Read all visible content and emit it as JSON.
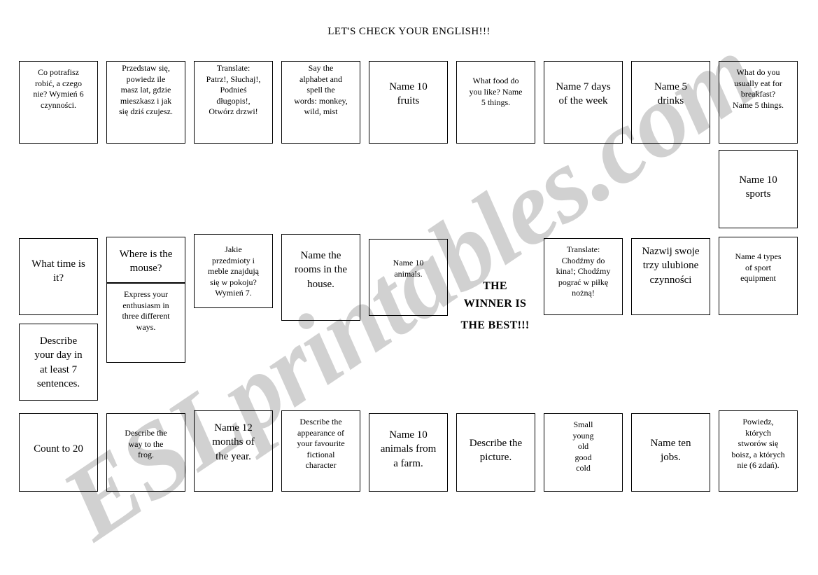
{
  "page": {
    "title": "LET'S CHECK YOUR ENGLISH!!!",
    "watermark": "ESLprintables.com",
    "background_color": "#ffffff",
    "border_color": "#000000",
    "watermark_color": "#c9c9c9"
  },
  "winner": {
    "line1": "THE",
    "line2": "WINNER IS",
    "line3": "THE BEST!!!"
  },
  "rows": {
    "top": [
      {
        "text": "Co potrafisz\nrobić, a czego\nnie? Wymień 6\nczynności."
      },
      {
        "text": "Przedstaw się,\npowiedz ile\nmasz lat, gdzie\nmieszkasz i jak\nsię dziś czujesz."
      },
      {
        "text": "Translate:\nPatrz!, Słuchaj!,\nPodnieś\ndługopis!,\nOtwórz drzwi!"
      },
      {
        "text": "Say the\nalphabet and\nspell the\nwords: monkey,\nwild, mist"
      },
      {
        "text": "Name 10\nfruits"
      },
      {
        "text": "What food do\nyou like? Name\n5 things."
      },
      {
        "text": "Name 7 days\nof the week"
      },
      {
        "text": "Name 5\ndrinks"
      },
      {
        "text": "What do you\nusually eat for\nbreakfast?\nName 5 things."
      }
    ],
    "sports": {
      "text": "Name 10\nsports"
    },
    "middle": [
      {
        "text": "What time is\nit?"
      },
      {
        "text": "Where is the\nmouse?"
      },
      {
        "text": "Jakie\nprzedmioty i\nmeble znajdują\nsię w pokoju?\nWymień 7."
      },
      {
        "text": "Name the\nrooms in the\nhouse."
      },
      {
        "text": "Name 10\nanimals."
      },
      {
        "text": "Translate:\nChodźmy do\nkina!; Chodźmy\npograć w piłkę\nnożną!"
      },
      {
        "text": "Nazwij swoje\ntrzy ulubione\nczynności"
      },
      {
        "text": "Name 4 types\nof sport\nequipment"
      }
    ],
    "middle_extra": [
      {
        "text": "Describe\nyour day in\nat least 7\nsentences."
      },
      {
        "text": "Express your\nenthusiasm in\nthree different\nways."
      }
    ],
    "bottom": [
      {
        "text": "Count to 20"
      },
      {
        "text": "Describe the\nway to the\nfrog."
      },
      {
        "text": "Name 12\nmonths of\nthe year."
      },
      {
        "text": "Describe the\nappearance of\nyour favourite\nfictional\ncharacter"
      },
      {
        "text": "Name 10\nanimals from\na farm."
      },
      {
        "text": "Describe the\npicture."
      },
      {
        "text": "Small\nyoung\nold\ngood\ncold"
      },
      {
        "text": "Name ten\njobs."
      },
      {
        "text": "Powiedz,\nktórych\nstworów się\nboisz, a których\nnie (6 zdań)."
      }
    ]
  }
}
